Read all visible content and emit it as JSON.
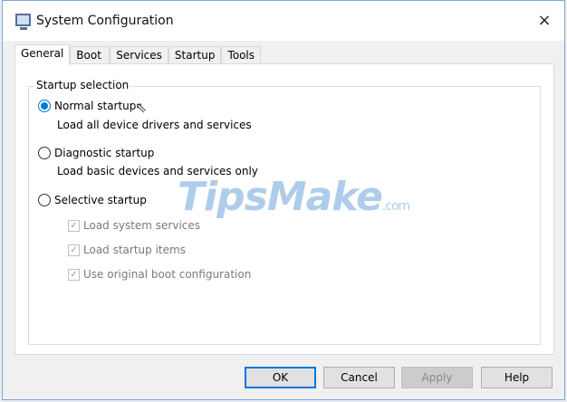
{
  "window": {
    "title": "System Configuration",
    "close_icon": "×"
  },
  "tabs": [
    {
      "label": "General",
      "active": true
    },
    {
      "label": "Boot"
    },
    {
      "label": "Services"
    },
    {
      "label": "Startup"
    },
    {
      "label": "Tools"
    }
  ],
  "general": {
    "group_label": "Startup selection",
    "normal": {
      "label": "Normal startup",
      "desc": "Load all device drivers and services",
      "selected": true
    },
    "diagnostic": {
      "label": "Diagnostic startup",
      "desc": "Load basic devices and services only",
      "selected": false
    },
    "selective": {
      "label": "Selective startup",
      "selected": false
    },
    "options": [
      {
        "label": "Load system services",
        "checked": true,
        "disabled": true
      },
      {
        "label": "Load startup items",
        "checked": true,
        "disabled": true
      },
      {
        "label": "Use original boot configuration",
        "checked": true,
        "disabled": true
      }
    ]
  },
  "watermark": {
    "text": "TipsMake",
    ".com": ".com"
  },
  "buttons": {
    "ok": "OK",
    "cancel": "Cancel",
    "apply": "Apply",
    "help": "Help"
  }
}
